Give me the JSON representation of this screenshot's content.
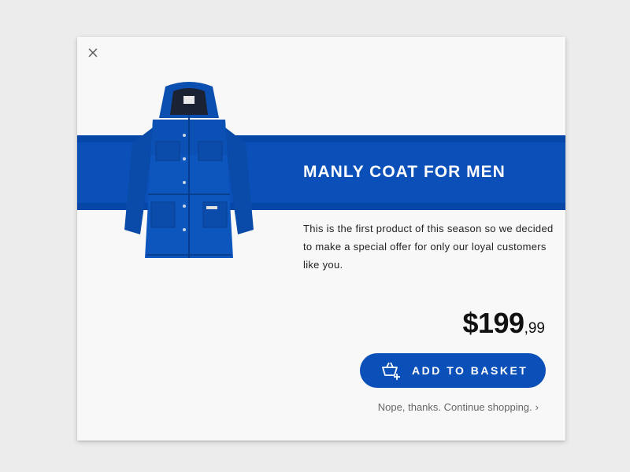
{
  "modal": {
    "close_icon": "close-icon",
    "title": "MANLY COAT FOR MEN",
    "description": "This is the first product of this season so we decided to make a special offer for only our loyal customers like you.",
    "price": {
      "main": "$199",
      "cents": ",99"
    },
    "add_button": {
      "label": "ADD TO BASKET",
      "icon": "basket-add-icon"
    },
    "dismiss": {
      "label": "Nope, thanks. Continue shopping.",
      "chevron": "›"
    },
    "product_image": "blue-hooded-jacket",
    "colors": {
      "accent": "#0a50b8",
      "background": "#ececec",
      "card": "#f8f8f8"
    }
  }
}
